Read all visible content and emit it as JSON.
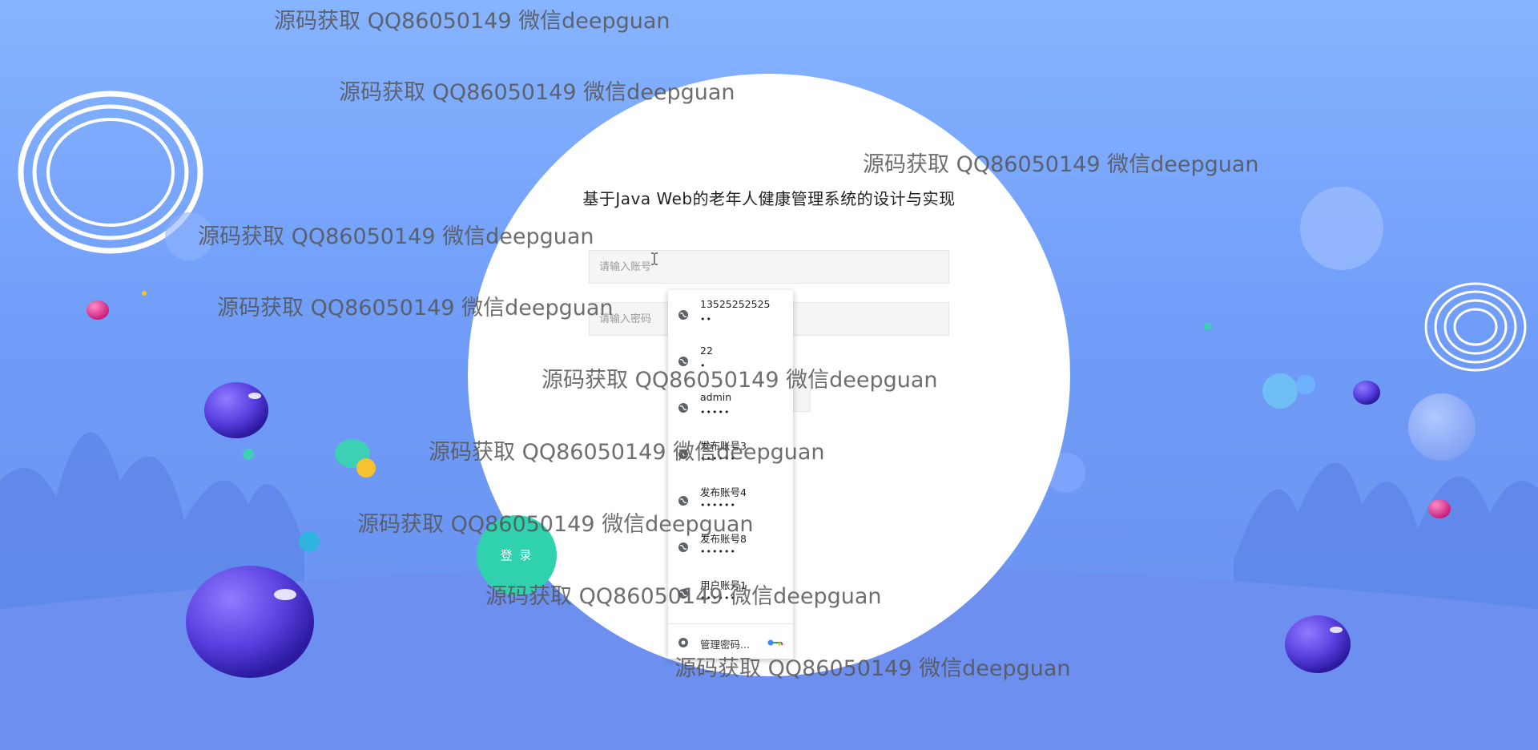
{
  "page": {
    "title": "基于Java Web的老年人健康管理系统的设计与实现"
  },
  "login": {
    "account_placeholder": "请输入账号",
    "password_placeholder": "请输入密码",
    "login_button": "登 录"
  },
  "autocomplete": {
    "items": [
      {
        "username": "13525252525",
        "password_mask": "••"
      },
      {
        "username": "22",
        "password_mask": "•"
      },
      {
        "username": "admin",
        "password_mask": "•••••"
      },
      {
        "username": "发布账号3",
        "password_mask": "••••••"
      },
      {
        "username": "发布账号4",
        "password_mask": "••••••"
      },
      {
        "username": "发布账号8",
        "password_mask": "••••••"
      },
      {
        "username": "用户账号1",
        "password_mask": "••••••"
      }
    ],
    "manage_label": "管理密码...",
    "item_icon": "globe-icon",
    "manage_icon": "chrome-icon",
    "key_icon": "key-icon"
  },
  "watermarks": [
    "源码获取 QQ86050149 微信deepguan",
    "源码获取 QQ86050149 微信deepguan",
    "源码获取 QQ86050149 微信deepguan",
    "源码获取 QQ86050149 微信deepguan",
    "源码获取 QQ86050149 微信deepguan",
    "源码获取 QQ86050149 微信deepguan",
    "源码获取 QQ86050149 微信deepguan",
    "源码获取 QQ86050149 微信deepguan",
    "源码获取 QQ86050149 微信deepguan",
    "源码获取 QQ86050149 微信deepguan"
  ],
  "colors": {
    "background_top": "#86b4ff",
    "background_bottom": "#6a90ee",
    "login_button": "#2fd1ae",
    "ball_purple": "#5a3fe0",
    "ball_pink": "#e0328e"
  }
}
